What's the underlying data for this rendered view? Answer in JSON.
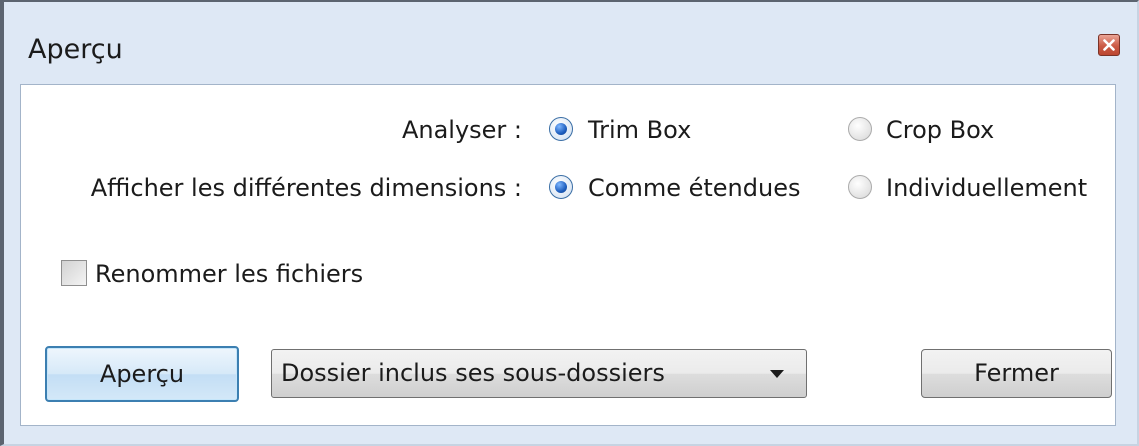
{
  "window": {
    "title": "Aperçu",
    "close_icon": "close-icon"
  },
  "analyser": {
    "label": "Analyser :",
    "options": [
      {
        "label": "Trim Box",
        "selected": true
      },
      {
        "label": "Crop Box",
        "selected": false
      }
    ]
  },
  "afficher": {
    "label": "Afficher les différentes dimensions :",
    "options": [
      {
        "label": "Comme étendues",
        "selected": true
      },
      {
        "label": "Individuellement",
        "selected": false
      }
    ]
  },
  "rename": {
    "label": "Renommer les fichiers",
    "checked": false
  },
  "buttons": {
    "apercu": "Aperçu",
    "fermer": "Fermer"
  },
  "folder_select": {
    "value": "Dossier inclus ses sous-dossiers"
  },
  "colors": {
    "window_bg": "#dee8f5",
    "panel_bg": "#ffffff",
    "radio_selected": "#1f5fbf",
    "default_button_border": "#3c7fb1",
    "close_button": "#cb5a45"
  }
}
